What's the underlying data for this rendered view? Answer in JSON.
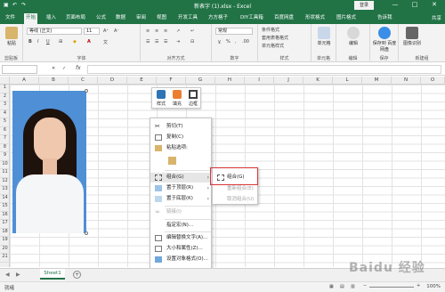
{
  "titlebar": {
    "title": "新表字 (1).xlsx - Excel",
    "login": "登录",
    "quick_access": [
      "保存",
      "撤销",
      "恢复"
    ],
    "window_controls": [
      "—",
      "□",
      "✕"
    ]
  },
  "tabs": [
    "文件",
    "开始",
    "插入",
    "页面布局",
    "公式",
    "数据",
    "审阅",
    "视图",
    "开发工具",
    "方方格子",
    "DIY工具箱",
    "百度网盘",
    "形状格式",
    "图片格式",
    "告诉我"
  ],
  "active_tab": "开始",
  "share": "共享",
  "ribbon": {
    "paste": "粘贴",
    "clipboard": "剪贴板",
    "font_name": "等线 (正文)",
    "font_size": "11",
    "font_group": "字体",
    "align_group": "对齐方式",
    "number_format": "常规",
    "number_group": "数字",
    "conditional_format": "条件格式",
    "table_format": "套用表格格式",
    "cell_styles": "单元格样式",
    "styles_group": "样式",
    "cells": "单元格",
    "cells_group": "单元格",
    "editing": "编辑",
    "editing_group": "编辑",
    "baidu_save": "保存到\n百度网盘",
    "baidu_group": "保存",
    "photo_btn": "图像识别",
    "new_group": "新建组"
  },
  "formula_bar": {
    "fx": "fx"
  },
  "columns": [
    "A",
    "B",
    "C",
    "D",
    "E",
    "F",
    "G",
    "H",
    "I",
    "J",
    "K",
    "L",
    "M",
    "N",
    "O"
  ],
  "rows": [
    "1",
    "2",
    "3",
    "4",
    "5",
    "6",
    "7",
    "8",
    "9",
    "10",
    "11",
    "12",
    "13",
    "14",
    "15",
    "16",
    "17",
    "18",
    "19",
    "20",
    "21"
  ],
  "format_toolbar": [
    {
      "label": "样式",
      "color": "#2e75b6"
    },
    {
      "label": "填充",
      "color": "#ed7d31"
    },
    {
      "label": "边框",
      "color": "#404040"
    }
  ],
  "context_menu": [
    {
      "label": "剪切(T)",
      "icon": "scissors-icon",
      "disabled": false
    },
    {
      "label": "复制(C)",
      "icon": "copy-icon",
      "disabled": false
    },
    {
      "label": "粘贴选项:",
      "icon": "paste-icon",
      "disabled": false
    },
    {
      "label": "",
      "icon": "paste-option-icon",
      "disabled": false
    },
    {
      "label": "组合(G)",
      "icon": "group-icon",
      "disabled": false,
      "submenu": true,
      "highlighted": true
    },
    {
      "label": "置于顶层(R)",
      "icon": "bring-front-icon",
      "disabled": false,
      "submenu": true
    },
    {
      "label": "置于底层(K)",
      "icon": "send-back-icon",
      "disabled": false,
      "submenu": true
    },
    {
      "label": "链接(I)",
      "icon": "link-icon",
      "disabled": true
    },
    {
      "label": "指定宏(N)...",
      "icon": "",
      "disabled": false
    },
    {
      "label": "编辑替换文字(A)...",
      "icon": "alt-text-icon",
      "disabled": false
    },
    {
      "label": "大小和属性(Z)...",
      "icon": "size-icon",
      "disabled": false
    },
    {
      "label": "设置对象格式(O)...",
      "icon": "format-object-icon",
      "disabled": false
    }
  ],
  "submenu": [
    {
      "label": "组合(G)",
      "disabled": false
    },
    {
      "label": "重新组合(E)",
      "disabled": true
    },
    {
      "label": "取消组合(U)",
      "disabled": true
    }
  ],
  "sheet_tab": "Sheet1",
  "status": {
    "ready": "就绪",
    "zoom": "100%"
  },
  "watermark": "Baidu 经验"
}
